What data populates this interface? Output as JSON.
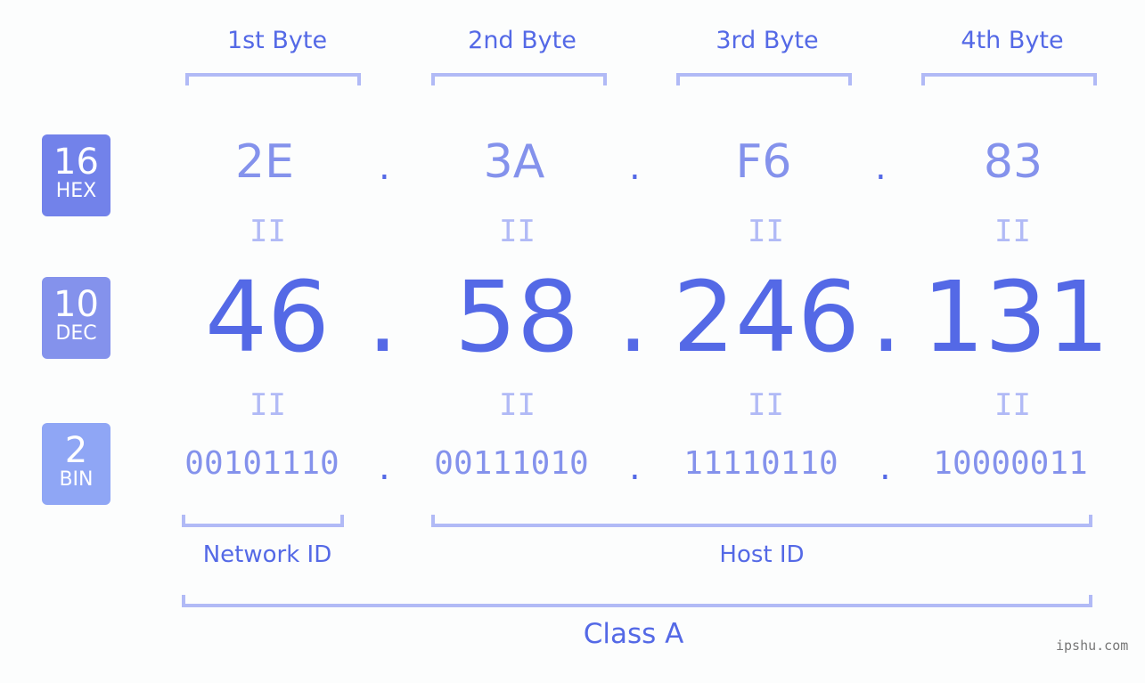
{
  "bytes": [
    {
      "label": "1st Byte",
      "hex": "2E",
      "dec": "46",
      "bin": "00101110"
    },
    {
      "label": "2nd Byte",
      "hex": "3A",
      "dec": "58",
      "bin": "00111010"
    },
    {
      "label": "3rd Byte",
      "hex": "F6",
      "dec": "246",
      "bin": "11110110"
    },
    {
      "label": "4th Byte",
      "hex": "83",
      "dec": "131",
      "bin": "10000011"
    }
  ],
  "badges": {
    "hex": {
      "num": "16",
      "label": "HEX",
      "color": "#7282ea"
    },
    "dec": {
      "num": "10",
      "label": "DEC",
      "color": "#8492ec"
    },
    "bin": {
      "num": "2",
      "label": "BIN",
      "color": "#8fa6f5"
    }
  },
  "separator": ".",
  "equals": "II",
  "labels": {
    "network_id": "Network ID",
    "host_id": "Host ID",
    "class": "Class A"
  },
  "watermark": "ipshu.com",
  "colors": {
    "accent": "#5469e6",
    "light": "#8492ec",
    "bracket": "#b1baf6"
  }
}
